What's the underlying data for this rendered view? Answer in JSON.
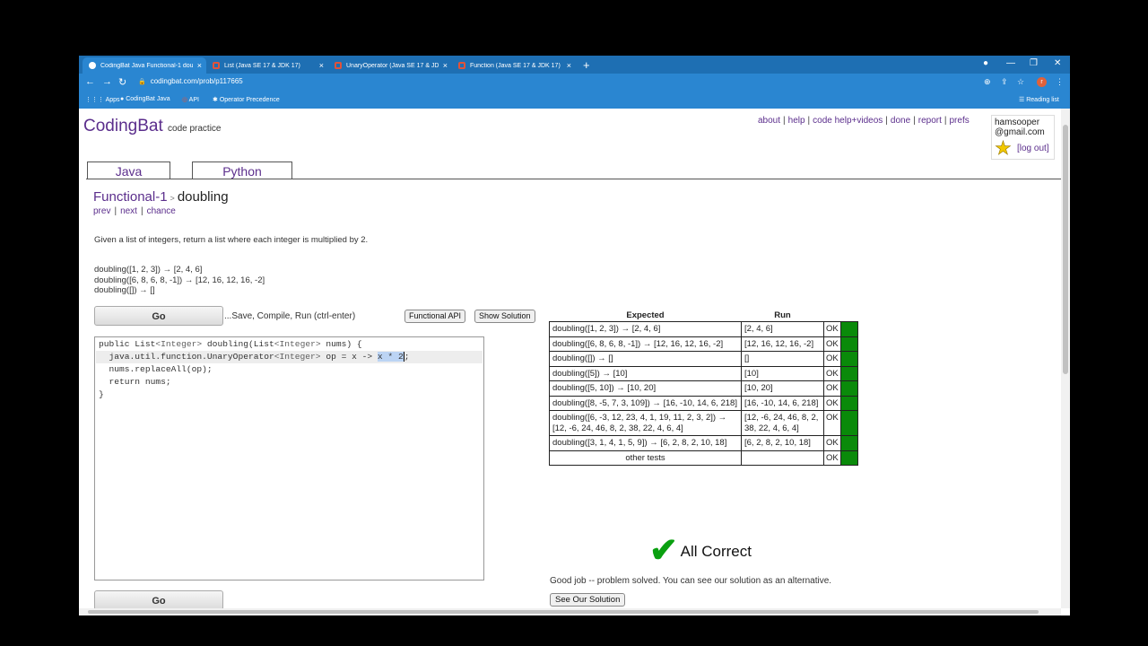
{
  "browser": {
    "tabs": [
      {
        "title": "CodingBat Java Functional-1 dou...",
        "close": "×"
      },
      {
        "title": "List (Java SE 17 & JDK 17)",
        "close": "×"
      },
      {
        "title": "UnaryOperator (Java SE 17 & JDK...",
        "close": "×"
      },
      {
        "title": "Function (Java SE 17 & JDK 17)",
        "close": "×"
      }
    ],
    "new_tab": "+",
    "url": "codingbat.com/prob/p117665",
    "bookmarks": [
      "Apps",
      "CodingBat Java",
      "API",
      "Operator Precedence"
    ],
    "reading_list": "Reading list",
    "profile_initial": "r"
  },
  "site": {
    "logo": "CodingBat",
    "logo_sub": "code practice",
    "links": [
      "about",
      "help",
      "code help+videos",
      "done",
      "report",
      "prefs"
    ],
    "user_line1": "hamsooper",
    "user_line2": "@gmail.com",
    "logout": "[log out]",
    "lang_tabs": [
      "Java",
      "Python"
    ]
  },
  "problem": {
    "section": "Functional-1",
    "sep": ">",
    "name": "doubling",
    "nav": [
      "prev",
      "next",
      "chance"
    ],
    "description": "Given a list of integers, return a list where each integer is multiplied by 2.",
    "examples": [
      "doubling([1, 2, 3]) → [2, 4, 6]",
      "doubling([6, 8, 6, 8, -1]) → [12, 16, 12, 16, -2]",
      "doubling([]) → []"
    ]
  },
  "editor": {
    "go_label": "Go",
    "save_hint": "...Save, Compile, Run (ctrl-enter)",
    "functional_api": "Functional API",
    "show_solution": "Show Solution",
    "code": {
      "l1a": "public List",
      "l1b": "<Integer>",
      "l1c": " doubling(List",
      "l1d": "<Integer>",
      "l1e": " nums) {",
      "l2a": "  java.util.function.UnaryOperator",
      "l2b": "<Integer>",
      "l2c": " op = x -> ",
      "l2d": "x * 2",
      "l2e": ";",
      "l3": "  nums.replaceAll(op);",
      "l4": "  return nums;",
      "l5": "}"
    }
  },
  "results": {
    "headers": [
      "Expected",
      "Run"
    ],
    "rows": [
      {
        "expected": "doubling([1, 2, 3]) → [2, 4, 6]",
        "run": "[2, 4, 6]",
        "status": "OK"
      },
      {
        "expected": "doubling([6, 8, 6, 8, -1]) → [12, 16, 12, 16, -2]",
        "run": "[12, 16, 12, 16, -2]",
        "status": "OK"
      },
      {
        "expected": "doubling([]) → []",
        "run": "[]",
        "status": "OK"
      },
      {
        "expected": "doubling([5]) → [10]",
        "run": "[10]",
        "status": "OK"
      },
      {
        "expected": "doubling([5, 10]) → [10, 20]",
        "run": "[10, 20]",
        "status": "OK"
      },
      {
        "expected": "doubling([8, -5, 7, 3, 109]) → [16, -10, 14, 6, 218]",
        "run": "[16, -10, 14, 6, 218]",
        "status": "OK"
      },
      {
        "expected": "doubling([6, -3, 12, 23, 4, 1, 19, 11, 2, 3, 2]) → [12, -6, 24, 46, 8, 2, 38, 22, 4, 6, 4]",
        "run": "[12, -6, 24, 46, 8, 2, 38, 22, 4, 6, 4]",
        "status": "OK"
      },
      {
        "expected": "doubling([3, 1, 4, 1, 5, 9]) → [6, 2, 8, 2, 10, 18]",
        "run": "[6, 2, 8, 2, 10, 18]",
        "status": "OK"
      },
      {
        "expected": "other tests",
        "run": "",
        "status": "OK"
      }
    ],
    "all_correct": "All Correct",
    "good_job": "Good job -- problem solved. You can see our solution as an alternative.",
    "see_solution": "See Our Solution",
    "ok_color": "#0a8a0a"
  }
}
